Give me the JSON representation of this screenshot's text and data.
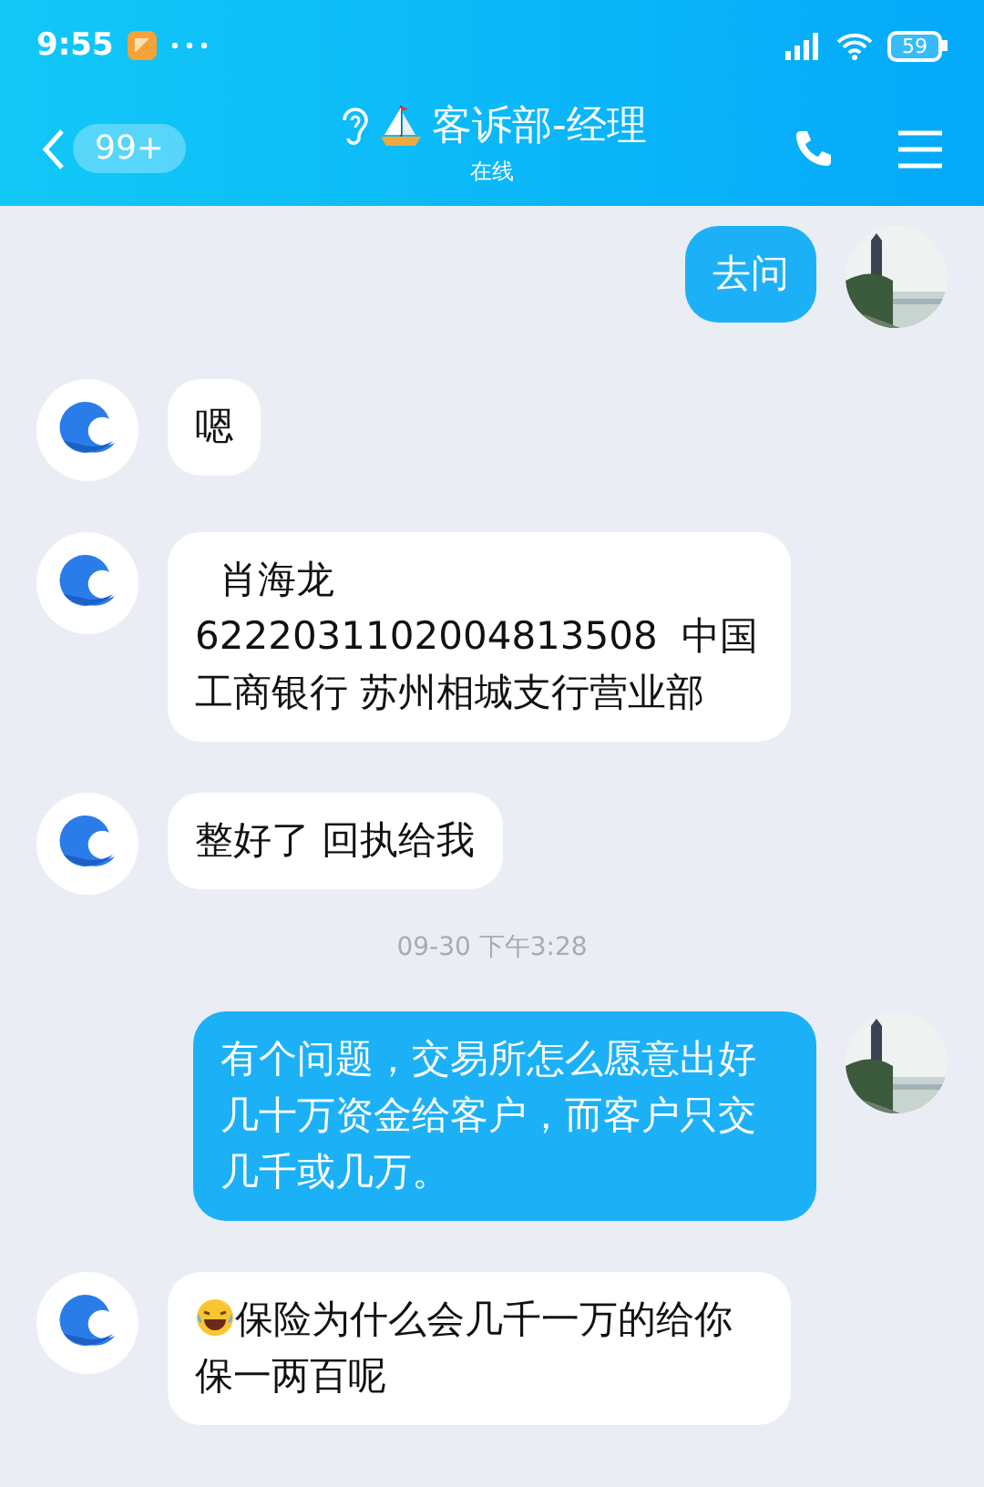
{
  "status_bar": {
    "time": "9:55",
    "battery": "59"
  },
  "nav": {
    "unread": "99+",
    "title": "客诉部-经理",
    "subtitle": "在线"
  },
  "messages": [
    {
      "kind": "sent",
      "text": "去问"
    },
    {
      "kind": "received",
      "text": "嗯"
    },
    {
      "kind": "received",
      "text": "  肖海龙\n6222031102004813508  中国工商银行 苏州相城支行营业部"
    },
    {
      "kind": "received",
      "text": "整好了 回执给我"
    },
    {
      "kind": "time",
      "text": "09-30 下午3:28"
    },
    {
      "kind": "sent",
      "text": "有个问题，交易所怎么愿意出好几十万资金给客户，而客户只交几千或几万。"
    },
    {
      "kind": "received",
      "emoji": true,
      "text": "保险为什么会几千一万的给你保一两百呢"
    }
  ]
}
